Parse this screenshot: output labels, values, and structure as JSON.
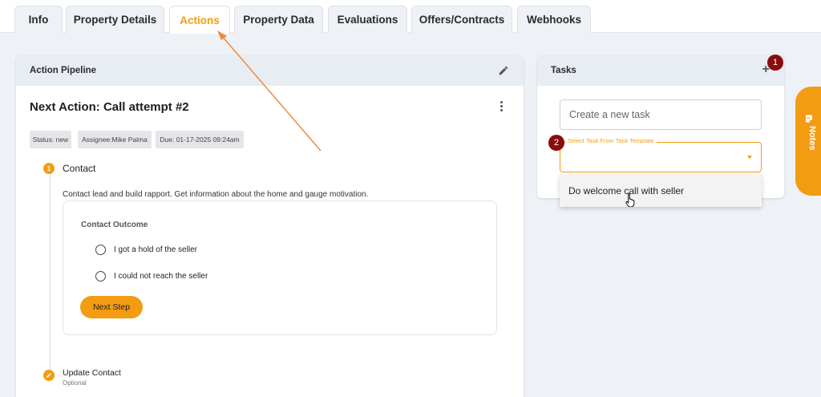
{
  "tabs": [
    {
      "label": "Info",
      "active": false
    },
    {
      "label": "Property Details",
      "active": false
    },
    {
      "label": "Actions",
      "active": true
    },
    {
      "label": "Property Data",
      "active": false
    },
    {
      "label": "Evaluations",
      "active": false
    },
    {
      "label": "Offers/Contracts",
      "active": false
    },
    {
      "label": "Webhooks",
      "active": false
    }
  ],
  "pipeline": {
    "header": "Action Pipeline",
    "next_action": "Next Action: Call attempt #2",
    "status": "Status: new",
    "assignee": "Assignee:Mike Palma",
    "due": "Due: 01-17-2025 09:24am",
    "step1": {
      "number": "1",
      "title": "Contact",
      "description": "Contact lead and build rapport. Get information about the home and gauge motivation.",
      "outcome_title": "Contact Outcome",
      "options": [
        "I got a hold of the seller",
        "I could not reach the seller"
      ],
      "button": "Next Step"
    },
    "step2": {
      "title": "Update Contact",
      "subtitle": "Optional"
    }
  },
  "tasks": {
    "header": "Tasks",
    "new_task_placeholder": "Create a new task",
    "select_label": "Select Task From Task Template",
    "dropdown_options": [
      "Do welcome call with seller"
    ]
  },
  "annotations": [
    "1",
    "2"
  ],
  "notes_label": "Notes",
  "colors": {
    "accent": "#f39c12",
    "annotation": "#8b0c0c",
    "header_bg": "#e8edf3",
    "page_bg": "#eef1f5"
  }
}
